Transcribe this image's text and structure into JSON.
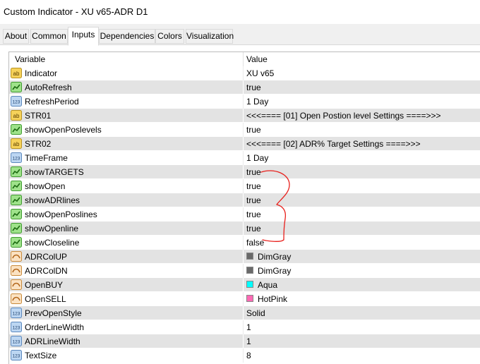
{
  "window": {
    "title": "Custom Indicator - XU v65-ADR D1"
  },
  "tabs": [
    {
      "label": "About"
    },
    {
      "label": "Common"
    },
    {
      "label": "Inputs"
    },
    {
      "label": "Dependencies"
    },
    {
      "label": "Colors"
    },
    {
      "label": "Visualization"
    }
  ],
  "active_tab": "Inputs",
  "grid": {
    "col_variable": "Variable",
    "col_value": "Value",
    "rows": [
      {
        "name": "Indicator",
        "value": "XU v65",
        "icon": "string-ab-icon"
      },
      {
        "name": "AutoRefresh",
        "value": "true",
        "icon": "bool-green-icon"
      },
      {
        "name": "RefreshPeriod",
        "value": "1 Day",
        "icon": "int-123-icon"
      },
      {
        "name": "STR01",
        "value": "<<<==== [01] Open Postion level Settings ====>>>",
        "icon": "string-ab-icon"
      },
      {
        "name": "showOpenPoslevels",
        "value": "true",
        "icon": "bool-green-icon"
      },
      {
        "name": "STR02",
        "value": "<<<==== [02] ADR% Target Settings ====>>>",
        "icon": "string-ab-icon"
      },
      {
        "name": "TimeFrame",
        "value": "1 Day",
        "icon": "int-123-icon"
      },
      {
        "name": "showTARGETS",
        "value": "true",
        "icon": "bool-green-icon"
      },
      {
        "name": "showOpen",
        "value": "true",
        "icon": "bool-green-icon"
      },
      {
        "name": "showADRlines",
        "value": "true",
        "icon": "bool-green-icon"
      },
      {
        "name": "showOpenPoslines",
        "value": "true",
        "icon": "bool-green-icon"
      },
      {
        "name": "showOpenline",
        "value": "true",
        "icon": "bool-green-icon"
      },
      {
        "name": "showCloseline",
        "value": "false",
        "icon": "bool-green-icon"
      },
      {
        "name": "ADRColUP",
        "value": "DimGray",
        "icon": "color-icon",
        "color": "#696969"
      },
      {
        "name": "ADRColDN",
        "value": "DimGray",
        "icon": "color-icon",
        "color": "#696969"
      },
      {
        "name": "OpenBUY",
        "value": "Aqua",
        "icon": "color-icon",
        "color": "#00ffff"
      },
      {
        "name": "OpenSELL",
        "value": "HotPink",
        "icon": "color-icon",
        "color": "#ff69b4"
      },
      {
        "name": "PrevOpenStyle",
        "value": "Solid",
        "icon": "int-123-icon"
      },
      {
        "name": "OrderLineWidth",
        "value": "1",
        "icon": "int-123-icon"
      },
      {
        "name": "ADRLineWidth",
        "value": "1",
        "icon": "int-123-icon"
      },
      {
        "name": "TextSize",
        "value": "8",
        "icon": "int-123-icon"
      }
    ]
  },
  "colors": {
    "row_shade": "#e3e3e3",
    "annotation": "#e8201c"
  }
}
